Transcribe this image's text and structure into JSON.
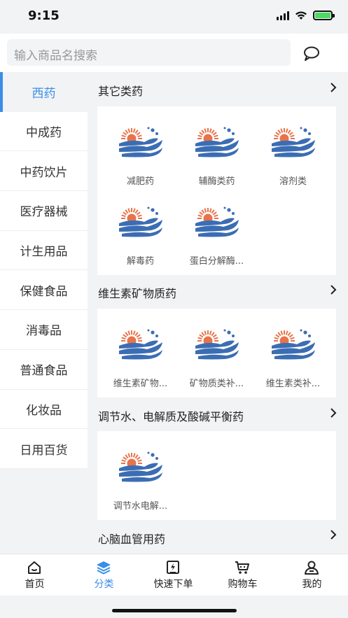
{
  "status_bar": {
    "time": "9:15"
  },
  "search": {
    "placeholder": "输入商品名搜索"
  },
  "sidebar": {
    "items": [
      {
        "label": "西药",
        "active": true
      },
      {
        "label": "中成药"
      },
      {
        "label": "中药饮片"
      },
      {
        "label": "医疗器械"
      },
      {
        "label": "计生用品"
      },
      {
        "label": "保健食品"
      },
      {
        "label": "消毒品"
      },
      {
        "label": "普通食品"
      },
      {
        "label": "化妆品"
      },
      {
        "label": "日用百货"
      }
    ]
  },
  "sections": [
    {
      "title": "其它类药",
      "items": [
        "减肥药",
        "辅酶类药",
        "溶剂类",
        "解毒药",
        "蛋白分解酶..."
      ]
    },
    {
      "title": "维生素矿物质药",
      "items": [
        "维生素矿物...",
        "矿物质类补...",
        "维生素类补..."
      ]
    },
    {
      "title": "调节水、电解质及酸碱平衡药",
      "items": [
        "调节水电解..."
      ]
    },
    {
      "title": "心脑血管用药",
      "items": []
    }
  ],
  "tabbar": {
    "tabs": [
      {
        "label": "首页",
        "icon": "home-icon"
      },
      {
        "label": "分类",
        "icon": "category-stack-icon",
        "active": true
      },
      {
        "label": "快速下单",
        "icon": "quick-order-icon"
      },
      {
        "label": "购物车",
        "icon": "cart-icon"
      },
      {
        "label": "我的",
        "icon": "user-icon"
      }
    ]
  },
  "colors": {
    "accent": "#3a8ee6",
    "logo_sun": "#e8734a",
    "logo_wave": "#3b6db3"
  }
}
